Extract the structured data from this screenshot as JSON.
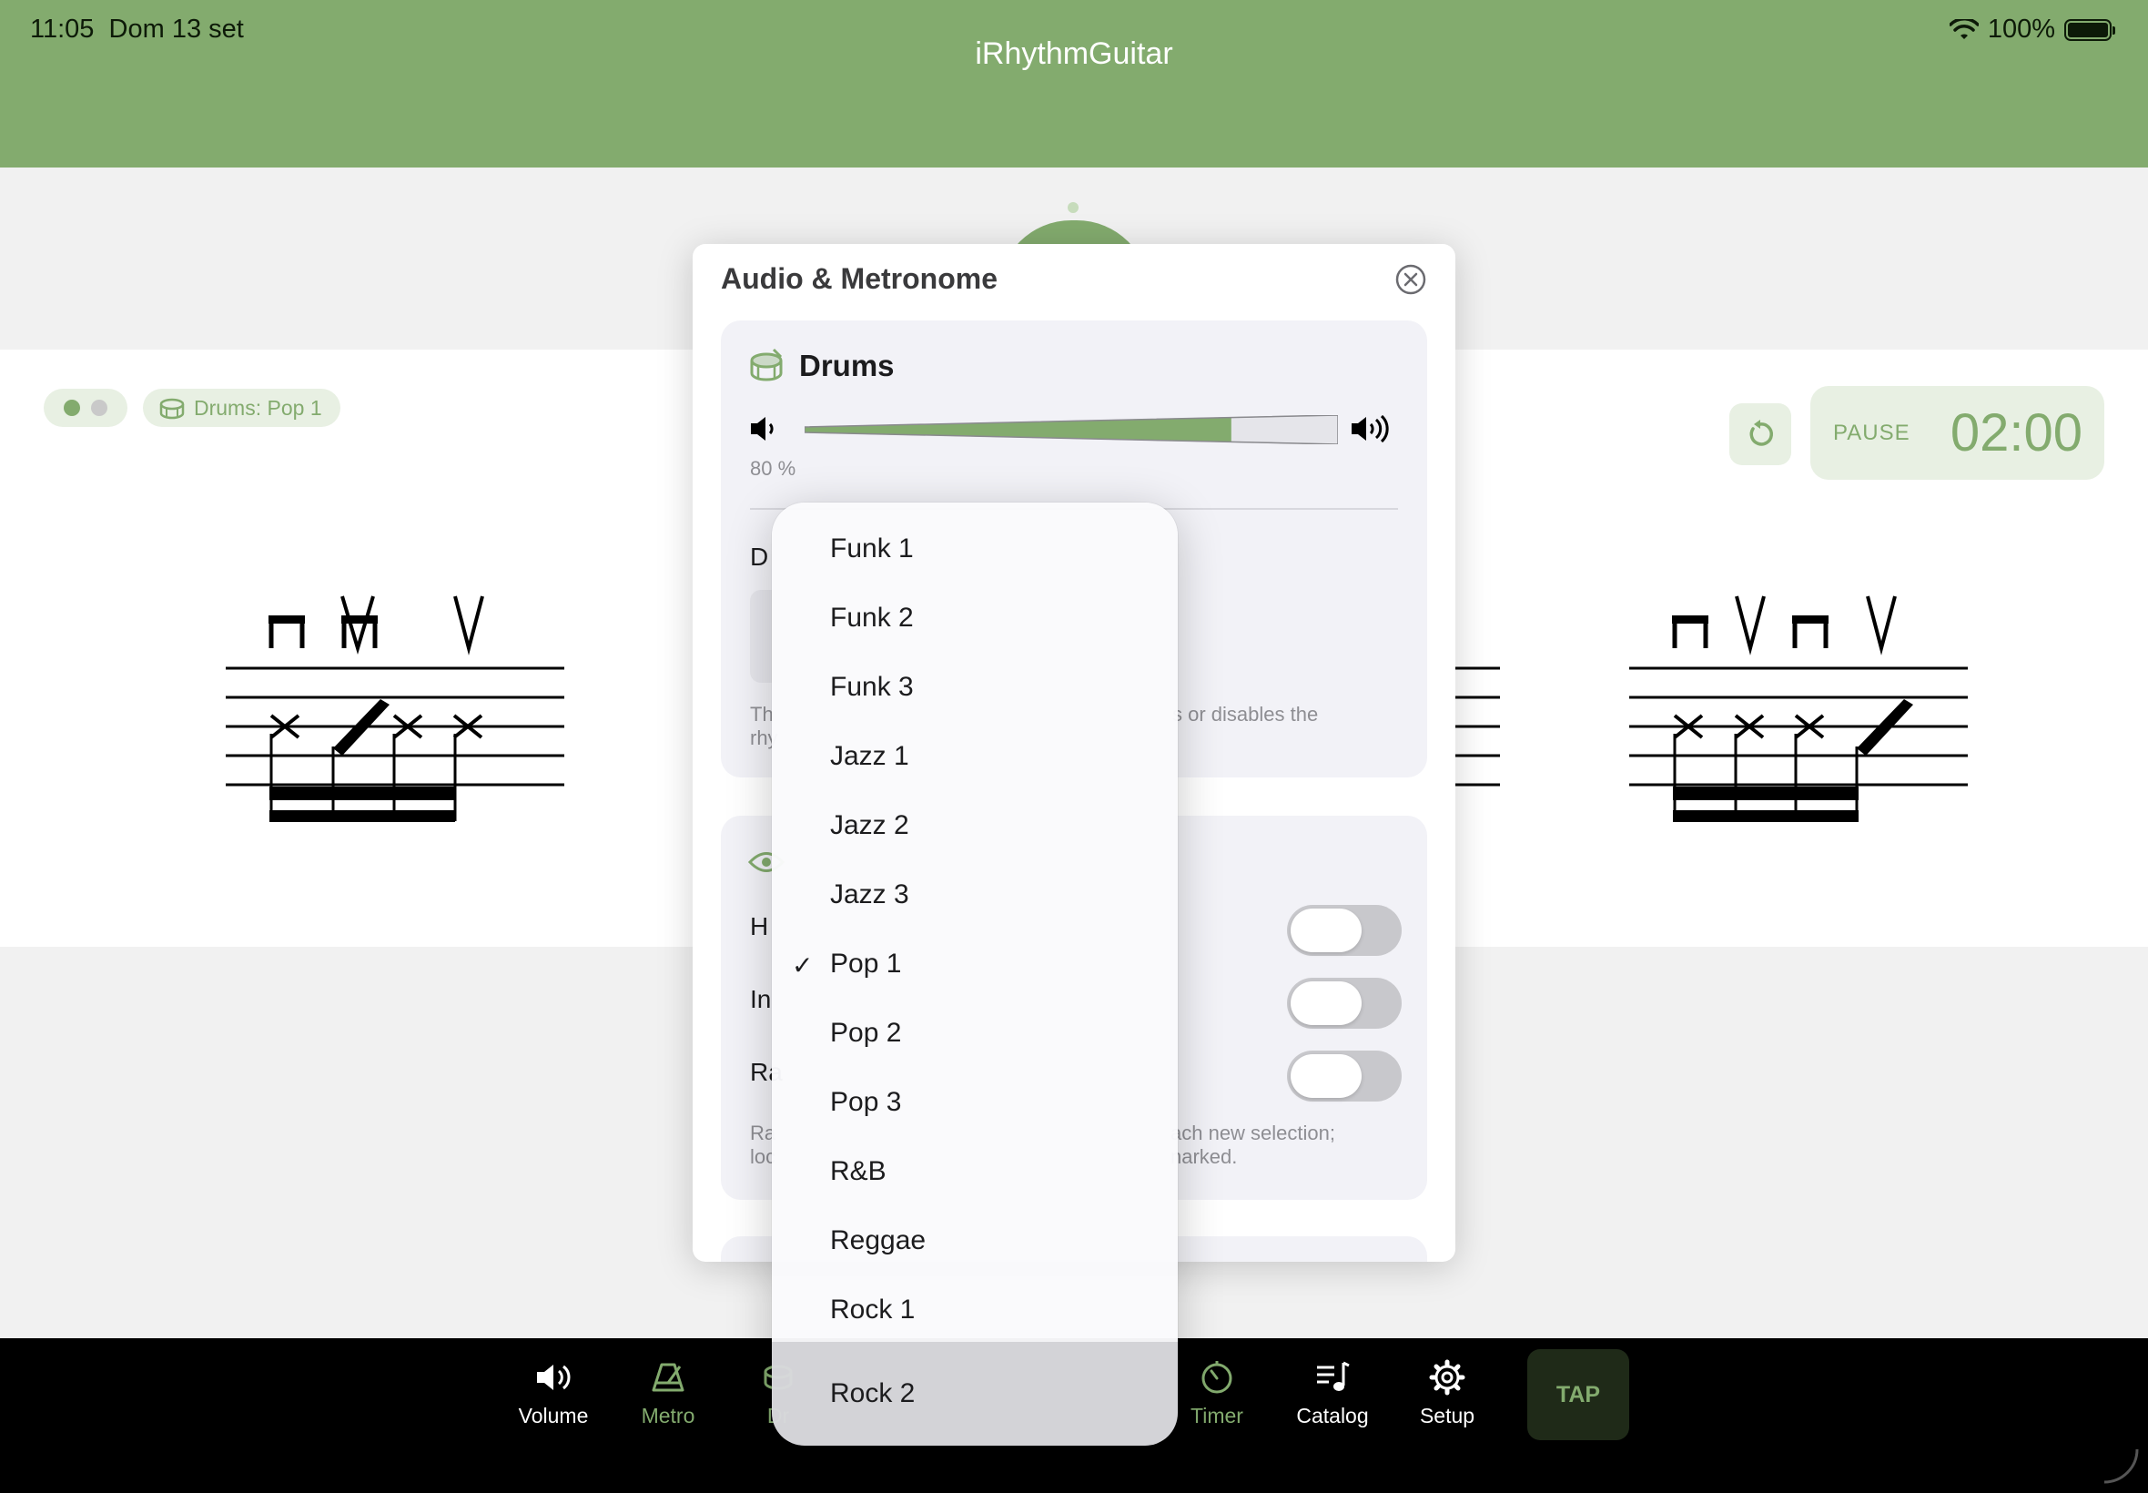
{
  "status_bar": {
    "time": "11:05",
    "date": "Dom 13 set",
    "battery": "100%"
  },
  "app": {
    "title": "iRhythmGuitar"
  },
  "chip": {
    "drums_label": "Drums: Pop 1"
  },
  "timer": {
    "pause_label": "PAUSE",
    "time": "02:00"
  },
  "dialog": {
    "title": "Audio & Metronome",
    "drums": {
      "heading": "Drums",
      "volume_percent": "80 %",
      "volume_level": 0.8,
      "partial_label": "D",
      "footnote_line1_start": "Th",
      "footnote_line1_end": "s or disables the",
      "footnote_line2_start": "rhy"
    },
    "display": {
      "row1_partial": "H",
      "row2_partial": "In",
      "row3_partial": "Ra",
      "footnote_line1_start": "Ra",
      "footnote_line1_end": "ach new selection;",
      "footnote_line2_start": "loc",
      "footnote_line2_end": "narked."
    }
  },
  "drum_menu": {
    "selected": "Pop 1",
    "items": [
      "Funk 1",
      "Funk 2",
      "Funk 3",
      "Jazz 1",
      "Jazz 2",
      "Jazz 3",
      "Pop 1",
      "Pop 2",
      "Pop 3",
      "R&B",
      "Reggae",
      "Rock 1",
      "Rock 2"
    ],
    "check": "✓"
  },
  "tabbar": {
    "volume": "Volume",
    "metro": "Metro",
    "drums_partial": "Dr",
    "timer": "Timer",
    "catalog": "Catalog",
    "setup": "Setup",
    "tap": "TAP"
  },
  "colors": {
    "accent": "#83ab6e",
    "header_bg": "#83ab6e",
    "tab_bg": "#000000"
  }
}
